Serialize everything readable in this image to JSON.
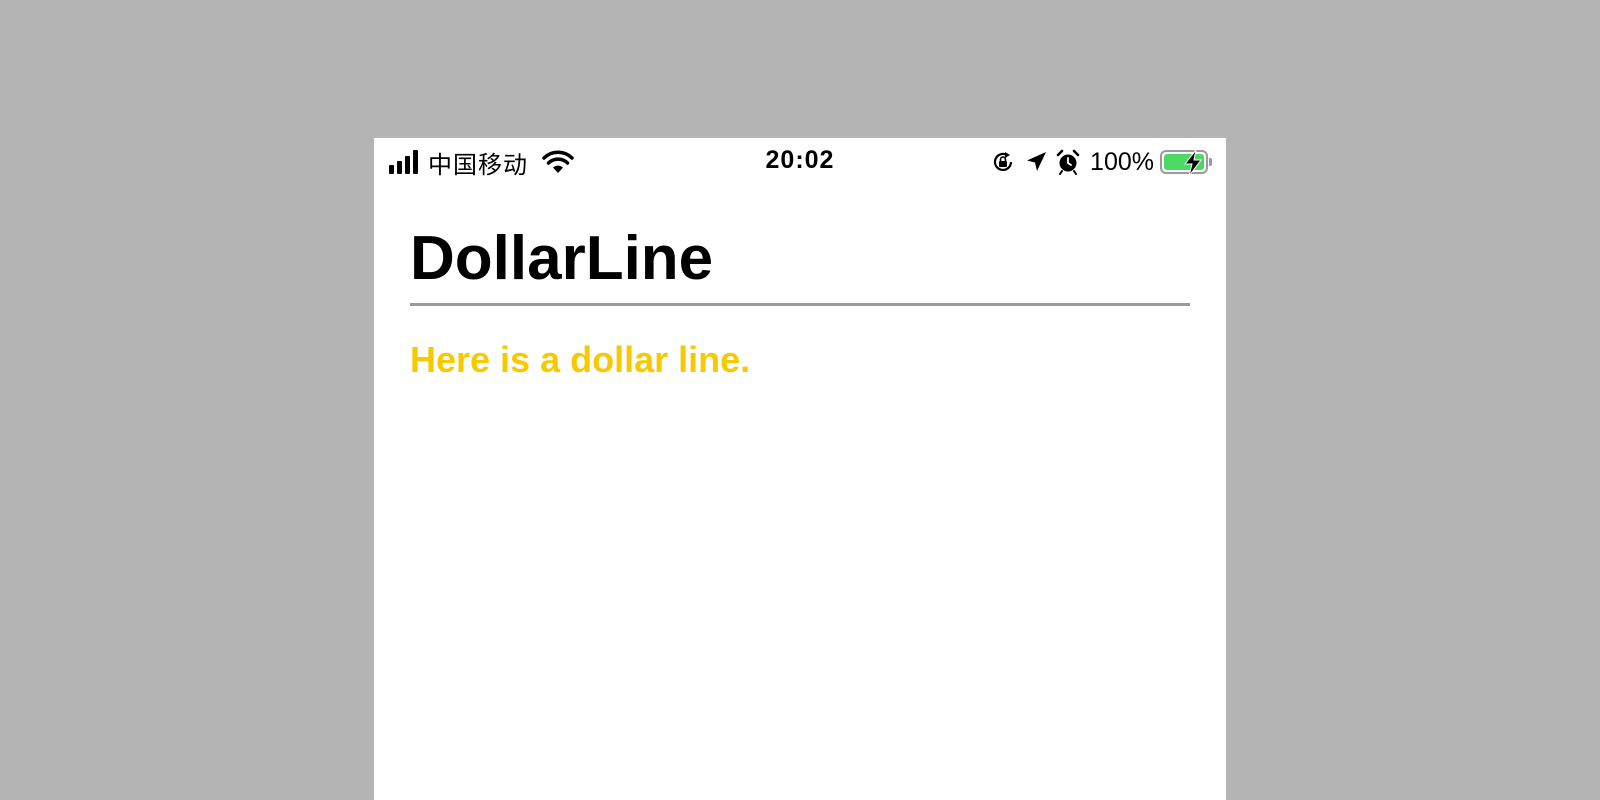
{
  "status_bar": {
    "carrier": "中国移动",
    "time": "20:02",
    "battery_percent": "100%",
    "signal_bars": 4,
    "battery_charging": true,
    "icons": [
      "signal-icon",
      "wifi-icon",
      "rotation-lock-icon",
      "location-icon",
      "alarm-icon",
      "battery-icon"
    ]
  },
  "page": {
    "title": "DollarLine",
    "body_text": "Here is a dollar line."
  },
  "colors": {
    "background": "#b4b4b4",
    "screen": "#ffffff",
    "body_text": "#f7c900",
    "divider": "#9b9b9b",
    "battery_fill": "#4cd964"
  }
}
